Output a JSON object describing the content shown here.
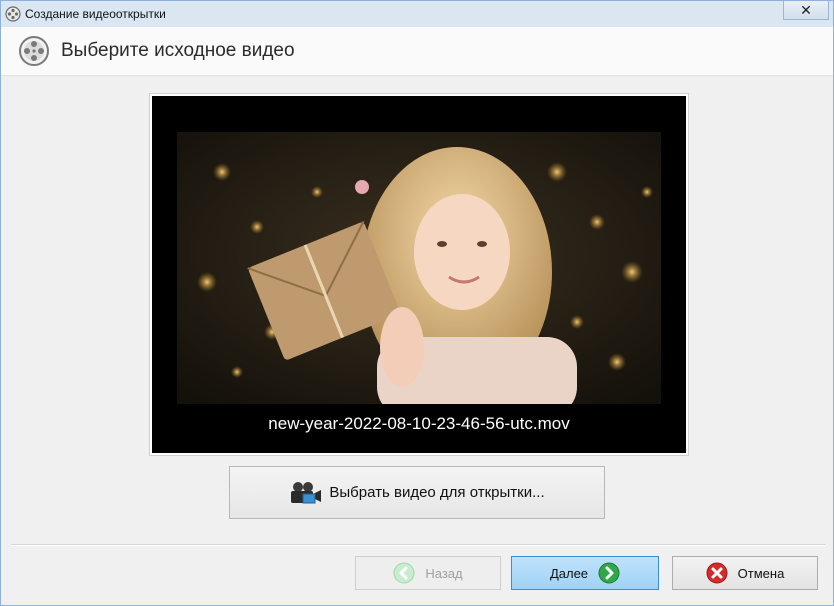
{
  "window": {
    "title": "Создание видеооткрытки",
    "close_symbol": "✕"
  },
  "header": {
    "title": "Выберите исходное видео",
    "icon": "film-reel-icon"
  },
  "preview": {
    "file_name": "new-year-2022-08-10-23-46-56-utc.mov"
  },
  "pick_button": {
    "label": "Выбрать видео для открытки...",
    "icon": "video-camera-icon"
  },
  "footer": {
    "back_label": "Назад",
    "next_label": "Далее",
    "cancel_label": "Отмена"
  },
  "colors": {
    "back_arrow": "#9fd8a8",
    "next_arrow": "#2fa84a",
    "cancel": "#d62b2b"
  }
}
